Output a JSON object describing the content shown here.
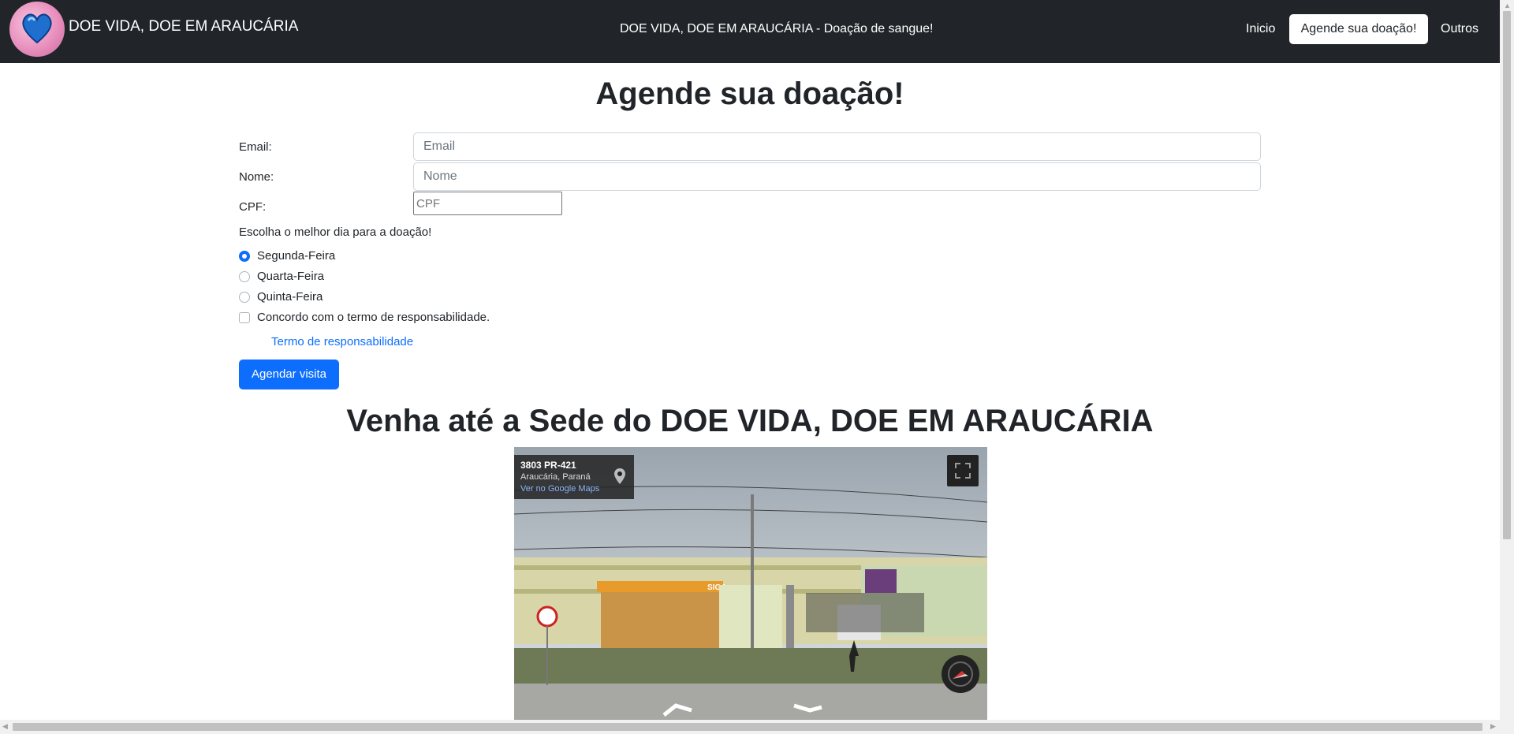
{
  "navbar": {
    "brand": "DOE VIDA, DOE EM ARAUCÁRIA",
    "center_text": "DOE VIDA, DOE EM ARAUCÁRIA - Doação de sangue!",
    "links": {
      "inicio": "Inicio",
      "agende": "Agende sua doação!",
      "outros": "Outros"
    }
  },
  "form": {
    "title": "Agende sua doação!",
    "email_label": "Email:",
    "email_placeholder": "Email",
    "nome_label": "Nome:",
    "nome_placeholder": "Nome",
    "cpf_label": "CPF:",
    "cpf_placeholder": "CPF",
    "day_prompt": "Escolha o melhor dia para a doação!",
    "days": [
      {
        "label": "Segunda-Feira",
        "checked": true
      },
      {
        "label": "Quarta-Feira",
        "checked": false
      },
      {
        "label": "Quinta-Feira",
        "checked": false
      }
    ],
    "agree_label": "Concordo com o termo de responsabilidade.",
    "terms_link": "Termo de responsabilidade",
    "submit_label": "Agendar visita"
  },
  "location": {
    "title": "Venha até a Sede do DOE VIDA, DOE EM ARAUCÁRIA",
    "streetview": {
      "address": "3803 PR-421",
      "city": "Araucária, Paraná",
      "maps_link": "Ver no Google Maps",
      "store_sign": "SIGA"
    }
  },
  "colors": {
    "navbar": "#212529",
    "primary": "#0d6efd"
  }
}
